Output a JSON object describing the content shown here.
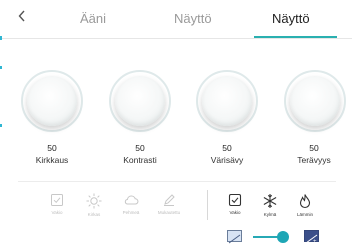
{
  "header": {
    "back_icon": "chevron-left-icon",
    "tabs": [
      {
        "label": "Ääni",
        "active": false
      },
      {
        "label": "Näyttö",
        "active": false
      },
      {
        "label": "Näyttö",
        "active": true
      }
    ]
  },
  "adjustments": [
    {
      "value": "50",
      "label": "Kirkkaus"
    },
    {
      "value": "50",
      "label": "Kontrasti"
    },
    {
      "value": "50",
      "label": "Värisävy"
    },
    {
      "value": "50",
      "label": "Terävyys"
    }
  ],
  "presets_left": [
    {
      "label": "Vakio",
      "icon": "checkbox-icon"
    },
    {
      "label": "Kirkas",
      "icon": "sun-icon"
    },
    {
      "label": "Pehmeä",
      "icon": "cloud-icon"
    },
    {
      "label": "Mukautettu",
      "icon": "pencil-icon"
    }
  ],
  "presets_right": [
    {
      "label": "Vakio",
      "icon": "checkbox-icon"
    },
    {
      "label": "Kylmä",
      "icon": "snowflake-icon"
    },
    {
      "label": "Lämmin",
      "icon": "flame-icon"
    }
  ],
  "color_temperature": {
    "left_icon": "cool-temperature-icon",
    "right_icon": "warm-temperature-icon",
    "level": 0.8
  },
  "colors": {
    "accent": "#2ab0b0",
    "active_tab_underline": "#2ab0b0"
  }
}
